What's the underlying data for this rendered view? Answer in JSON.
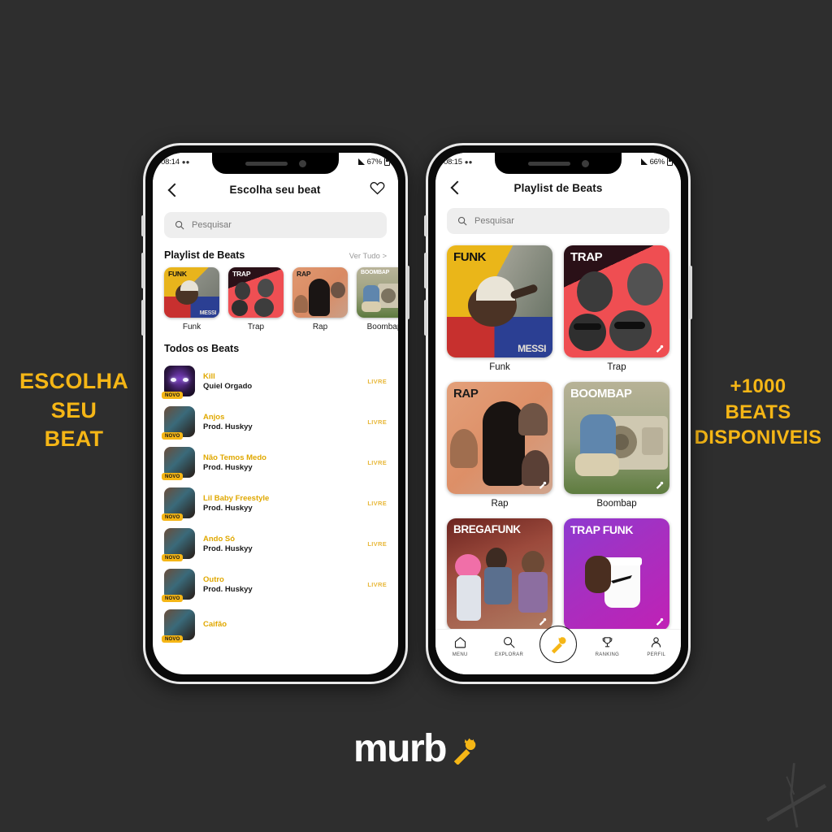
{
  "background_color": "#2e2e2e",
  "accent_color": "#f5b616",
  "promo": {
    "left": "ESCOLHA\nSEU\nBEAT",
    "right": "+1000\nBEATS\nDISPONIVEIS"
  },
  "brand": {
    "name": "murb",
    "icon": "microphone-crown-icon"
  },
  "phone_left": {
    "status_bar": {
      "time": "08:14",
      "battery": "67%"
    },
    "header": {
      "back_icon": "chevron-left-icon",
      "title": "Escolha seu beat",
      "favorite_icon": "heart-icon"
    },
    "search": {
      "placeholder": "Pesquisar",
      "icon": "search-icon"
    },
    "playlist_section": {
      "title": "Playlist de Beats",
      "see_all": "Ver Tudo >",
      "items": [
        {
          "label": "FUNK",
          "caption": "Funk"
        },
        {
          "label": "TRAP",
          "caption": "Trap"
        },
        {
          "label": "RAP",
          "caption": "Rap"
        },
        {
          "label": "BOOMBAP",
          "caption": "Boombap"
        }
      ]
    },
    "all_beats_section": {
      "title": "Todos os Beats",
      "badge_label": "NOVO",
      "free_label": "LIVRE",
      "items": [
        {
          "name": "Kill",
          "producer": "Quiel Orgado",
          "tag": "LIVRE",
          "badge": "NOVO"
        },
        {
          "name": "Anjos",
          "producer": "Prod. Huskyy",
          "tag": "LIVRE",
          "badge": "NOVO"
        },
        {
          "name": "Não Temos Medo",
          "producer": "Prod. Huskyy",
          "tag": "LIVRE",
          "badge": "NOVO"
        },
        {
          "name": "Lil Baby Freestyle",
          "producer": "Prod. Huskyy",
          "tag": "LIVRE",
          "badge": "NOVO"
        },
        {
          "name": "Ando Só",
          "producer": "Prod. Huskyy",
          "tag": "LIVRE",
          "badge": "NOVO"
        },
        {
          "name": "Outro",
          "producer": "Prod. Huskyy",
          "tag": "LIVRE",
          "badge": "NOVO"
        },
        {
          "name": "Caifão",
          "producer": "",
          "tag": "",
          "badge": "NOVO"
        }
      ]
    }
  },
  "phone_right": {
    "status_bar": {
      "time": "08:15",
      "battery": "66%"
    },
    "header": {
      "back_icon": "chevron-left-icon",
      "title": "Playlist de Beats"
    },
    "search": {
      "placeholder": "Pesquisar",
      "icon": "search-icon"
    },
    "grid": [
      {
        "label": "FUNK",
        "caption": "Funk"
      },
      {
        "label": "TRAP",
        "caption": "Trap"
      },
      {
        "label": "RAP",
        "caption": "Rap"
      },
      {
        "label": "BOOMBAP",
        "caption": "Boombap"
      },
      {
        "label": "BREGAFUNK",
        "caption": ""
      },
      {
        "label": "TRAP FUNK",
        "caption": ""
      }
    ],
    "bottom_nav": [
      {
        "label": "MENU",
        "icon": "home-icon"
      },
      {
        "label": "EXPLORAR",
        "icon": "search-icon"
      },
      {
        "label": "",
        "icon": "microphone-crown-icon"
      },
      {
        "label": "RANKING",
        "icon": "trophy-icon"
      },
      {
        "label": "PERFIL",
        "icon": "person-icon"
      }
    ]
  }
}
